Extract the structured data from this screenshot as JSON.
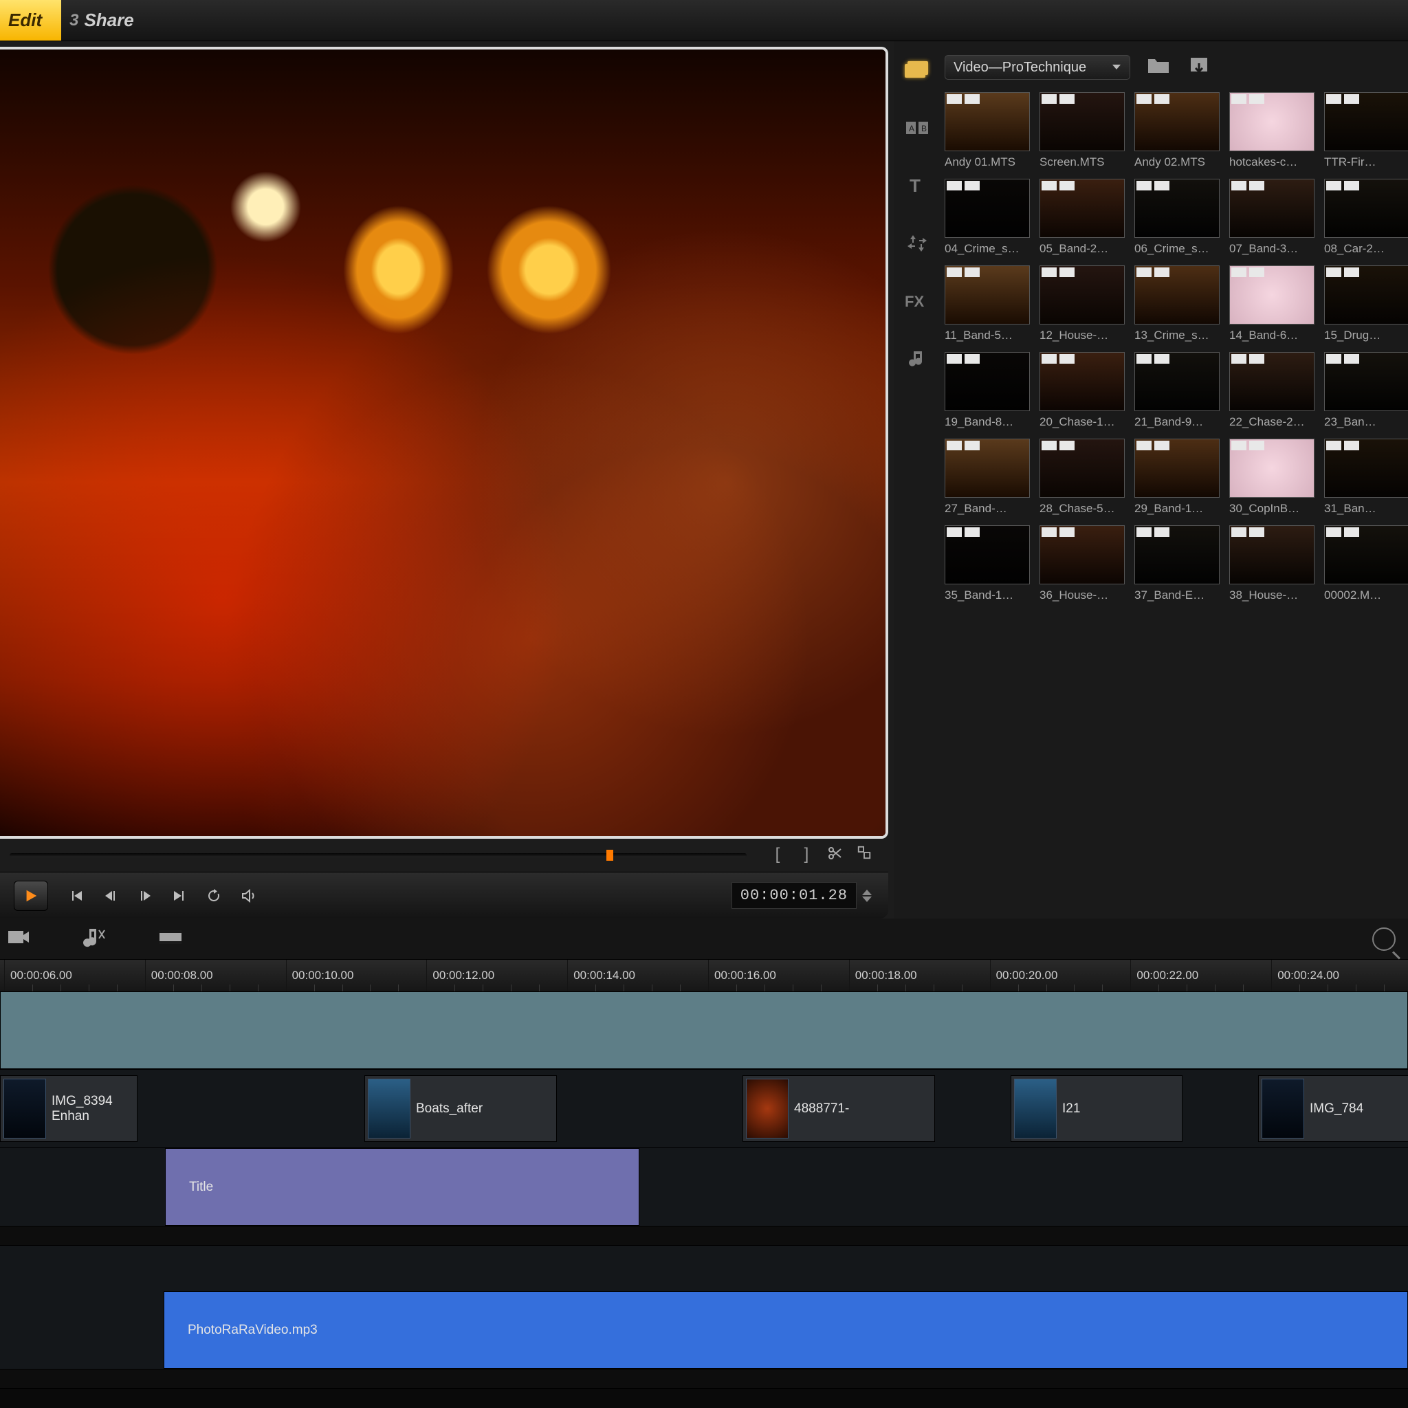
{
  "steps": {
    "edit": {
      "num": "",
      "label": "Edit"
    },
    "share": {
      "num": "3",
      "label": "Share"
    }
  },
  "preview": {
    "timecode": "00:00:01.28",
    "scrub_icons": {
      "mark_in": "[",
      "mark_out": "]"
    }
  },
  "library": {
    "dropdown": "Video—ProTechnique",
    "tabs": [
      "media",
      "transitions",
      "title",
      "graphics",
      "fx",
      "audio"
    ],
    "clips": [
      "Andy 01.MTS",
      "Screen.MTS",
      "Andy 02.MTS",
      "hotcakes-c…",
      "TTR-Fir…",
      "04_Crime_s…",
      "05_Band-2…",
      "06_Crime_s…",
      "07_Band-3…",
      "08_Car-2…",
      "11_Band-5…",
      "12_House-…",
      "13_Crime_s…",
      "14_Band-6…",
      "15_Drug…",
      "19_Band-8…",
      "20_Chase-1…",
      "21_Band-9…",
      "22_Chase-2…",
      "23_Ban…",
      "27_Band-…",
      "28_Chase-5…",
      "29_Band-1…",
      "30_CopInB…",
      "31_Ban…",
      "35_Band-1…",
      "36_House-…",
      "37_Band-E…",
      "38_House-…",
      "00002.M…"
    ]
  },
  "timeline": {
    "ruler": [
      "00:00:06.00",
      "00:00:08.00",
      "00:00:10.00",
      "00:00:12.00",
      "00:00:14.00",
      "00:00:16.00",
      "00:00:18.00",
      "00:00:20.00",
      "00:00:22.00",
      "00:00:24.00"
    ],
    "overlay": [
      {
        "label": "IMG_8394 Enhan",
        "kind": "dark"
      },
      {
        "label": "Boats_after",
        "kind": "blue"
      },
      {
        "label": "4888771-",
        "kind": "warm"
      },
      {
        "label": "I21",
        "kind": "blue"
      },
      {
        "label": "IMG_784",
        "kind": "dark"
      }
    ],
    "title_clip": "Title",
    "audio_clip": "PhotoRaRaVideo.mp3"
  }
}
